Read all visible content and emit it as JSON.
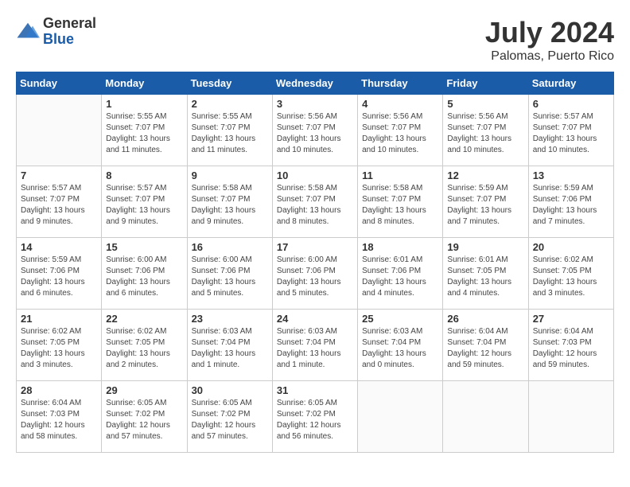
{
  "header": {
    "logo_general": "General",
    "logo_blue": "Blue",
    "month_year": "July 2024",
    "location": "Palomas, Puerto Rico"
  },
  "days_of_week": [
    "Sunday",
    "Monday",
    "Tuesday",
    "Wednesday",
    "Thursday",
    "Friday",
    "Saturday"
  ],
  "weeks": [
    [
      {
        "day": "",
        "info": ""
      },
      {
        "day": "1",
        "info": "Sunrise: 5:55 AM\nSunset: 7:07 PM\nDaylight: 13 hours\nand 11 minutes."
      },
      {
        "day": "2",
        "info": "Sunrise: 5:55 AM\nSunset: 7:07 PM\nDaylight: 13 hours\nand 11 minutes."
      },
      {
        "day": "3",
        "info": "Sunrise: 5:56 AM\nSunset: 7:07 PM\nDaylight: 13 hours\nand 10 minutes."
      },
      {
        "day": "4",
        "info": "Sunrise: 5:56 AM\nSunset: 7:07 PM\nDaylight: 13 hours\nand 10 minutes."
      },
      {
        "day": "5",
        "info": "Sunrise: 5:56 AM\nSunset: 7:07 PM\nDaylight: 13 hours\nand 10 minutes."
      },
      {
        "day": "6",
        "info": "Sunrise: 5:57 AM\nSunset: 7:07 PM\nDaylight: 13 hours\nand 10 minutes."
      }
    ],
    [
      {
        "day": "7",
        "info": "Sunrise: 5:57 AM\nSunset: 7:07 PM\nDaylight: 13 hours\nand 9 minutes."
      },
      {
        "day": "8",
        "info": "Sunrise: 5:57 AM\nSunset: 7:07 PM\nDaylight: 13 hours\nand 9 minutes."
      },
      {
        "day": "9",
        "info": "Sunrise: 5:58 AM\nSunset: 7:07 PM\nDaylight: 13 hours\nand 9 minutes."
      },
      {
        "day": "10",
        "info": "Sunrise: 5:58 AM\nSunset: 7:07 PM\nDaylight: 13 hours\nand 8 minutes."
      },
      {
        "day": "11",
        "info": "Sunrise: 5:58 AM\nSunset: 7:07 PM\nDaylight: 13 hours\nand 8 minutes."
      },
      {
        "day": "12",
        "info": "Sunrise: 5:59 AM\nSunset: 7:07 PM\nDaylight: 13 hours\nand 7 minutes."
      },
      {
        "day": "13",
        "info": "Sunrise: 5:59 AM\nSunset: 7:06 PM\nDaylight: 13 hours\nand 7 minutes."
      }
    ],
    [
      {
        "day": "14",
        "info": "Sunrise: 5:59 AM\nSunset: 7:06 PM\nDaylight: 13 hours\nand 6 minutes."
      },
      {
        "day": "15",
        "info": "Sunrise: 6:00 AM\nSunset: 7:06 PM\nDaylight: 13 hours\nand 6 minutes."
      },
      {
        "day": "16",
        "info": "Sunrise: 6:00 AM\nSunset: 7:06 PM\nDaylight: 13 hours\nand 5 minutes."
      },
      {
        "day": "17",
        "info": "Sunrise: 6:00 AM\nSunset: 7:06 PM\nDaylight: 13 hours\nand 5 minutes."
      },
      {
        "day": "18",
        "info": "Sunrise: 6:01 AM\nSunset: 7:06 PM\nDaylight: 13 hours\nand 4 minutes."
      },
      {
        "day": "19",
        "info": "Sunrise: 6:01 AM\nSunset: 7:05 PM\nDaylight: 13 hours\nand 4 minutes."
      },
      {
        "day": "20",
        "info": "Sunrise: 6:02 AM\nSunset: 7:05 PM\nDaylight: 13 hours\nand 3 minutes."
      }
    ],
    [
      {
        "day": "21",
        "info": "Sunrise: 6:02 AM\nSunset: 7:05 PM\nDaylight: 13 hours\nand 3 minutes."
      },
      {
        "day": "22",
        "info": "Sunrise: 6:02 AM\nSunset: 7:05 PM\nDaylight: 13 hours\nand 2 minutes."
      },
      {
        "day": "23",
        "info": "Sunrise: 6:03 AM\nSunset: 7:04 PM\nDaylight: 13 hours\nand 1 minute."
      },
      {
        "day": "24",
        "info": "Sunrise: 6:03 AM\nSunset: 7:04 PM\nDaylight: 13 hours\nand 1 minute."
      },
      {
        "day": "25",
        "info": "Sunrise: 6:03 AM\nSunset: 7:04 PM\nDaylight: 13 hours\nand 0 minutes."
      },
      {
        "day": "26",
        "info": "Sunrise: 6:04 AM\nSunset: 7:04 PM\nDaylight: 12 hours\nand 59 minutes."
      },
      {
        "day": "27",
        "info": "Sunrise: 6:04 AM\nSunset: 7:03 PM\nDaylight: 12 hours\nand 59 minutes."
      }
    ],
    [
      {
        "day": "28",
        "info": "Sunrise: 6:04 AM\nSunset: 7:03 PM\nDaylight: 12 hours\nand 58 minutes."
      },
      {
        "day": "29",
        "info": "Sunrise: 6:05 AM\nSunset: 7:02 PM\nDaylight: 12 hours\nand 57 minutes."
      },
      {
        "day": "30",
        "info": "Sunrise: 6:05 AM\nSunset: 7:02 PM\nDaylight: 12 hours\nand 57 minutes."
      },
      {
        "day": "31",
        "info": "Sunrise: 6:05 AM\nSunset: 7:02 PM\nDaylight: 12 hours\nand 56 minutes."
      },
      {
        "day": "",
        "info": ""
      },
      {
        "day": "",
        "info": ""
      },
      {
        "day": "",
        "info": ""
      }
    ]
  ]
}
